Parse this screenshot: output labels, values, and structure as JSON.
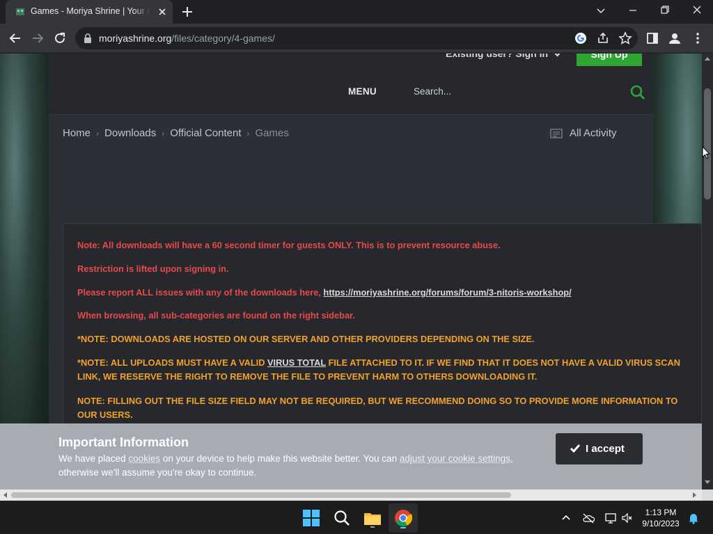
{
  "browser": {
    "tab_title": "Games - Moriya Shrine | Your resource",
    "url_domain": "moriyashrine.org",
    "url_path": "/files/category/4-games/"
  },
  "site": {
    "signin_label": "Existing user? Sign In",
    "signup_label": "Sign Up",
    "menu_label": "MENU",
    "search_placeholder": "Search...",
    "breadcrumb": {
      "home": "Home",
      "downloads": "Downloads",
      "official": "Official Content",
      "current": "Games",
      "sep": "›"
    },
    "all_activity": "All Activity"
  },
  "notice": {
    "line1": "Note: All downloads will have a 60 second timer for guests ONLY. This is to prevent resource abuse.",
    "line2": "Restriction is lifted upon signing in.",
    "line3_prefix": "Please report ALL issues with any of the downloads here, ",
    "line3_link": "https://moriyashrine.org/forums/forum/3-nitoris-workshop/",
    "line4": "When browsing, all sub-categories are found on the right sidebar.",
    "line5": "*NOTE: DOWNLOADS ARE HOSTED ON OUR SERVER AND OTHER PROVIDERS DEPENDING ON THE SIZE.",
    "line6_prefix": "*NOTE: ALL UPLOADS MUST HAVE A VALID ",
    "line6_link": "VIRUS TOTAL",
    "line6_suffix": " FILE ATTACHED TO IT. IF WE FIND THAT IT DOES NOT HAVE A VALID VIRUS SCAN LINK, WE RESERVE THE RIGHT TO REMOVE THE FILE TO PREVENT HARM TO OTHERS DOWNLOADING IT.",
    "line7": "NOTE: FILLING OUT THE FILE SIZE FIELD MAY NOT BE REQUIRED, BUT WE RECOMMEND DOING SO TO PROVIDE MORE INFORMATION TO OUR USERS.",
    "red_color": "#e84a4a",
    "orange_color": "#f1a22a"
  },
  "cookie": {
    "title": "Important Information",
    "text_a": "We have placed ",
    "link_cookies": "cookies",
    "text_b": " on your device to help make this website better. You can ",
    "link_settings": "adjust your cookie settings",
    "text_c": ", otherwise we'll assume you're okay to continue.",
    "accept_label": "I accept"
  },
  "taskbar": {
    "time": "1:13 PM",
    "date": "9/10/2023"
  },
  "colors": {
    "accent_green": "#2fa532",
    "cookie_bg": "#a7acb4"
  }
}
